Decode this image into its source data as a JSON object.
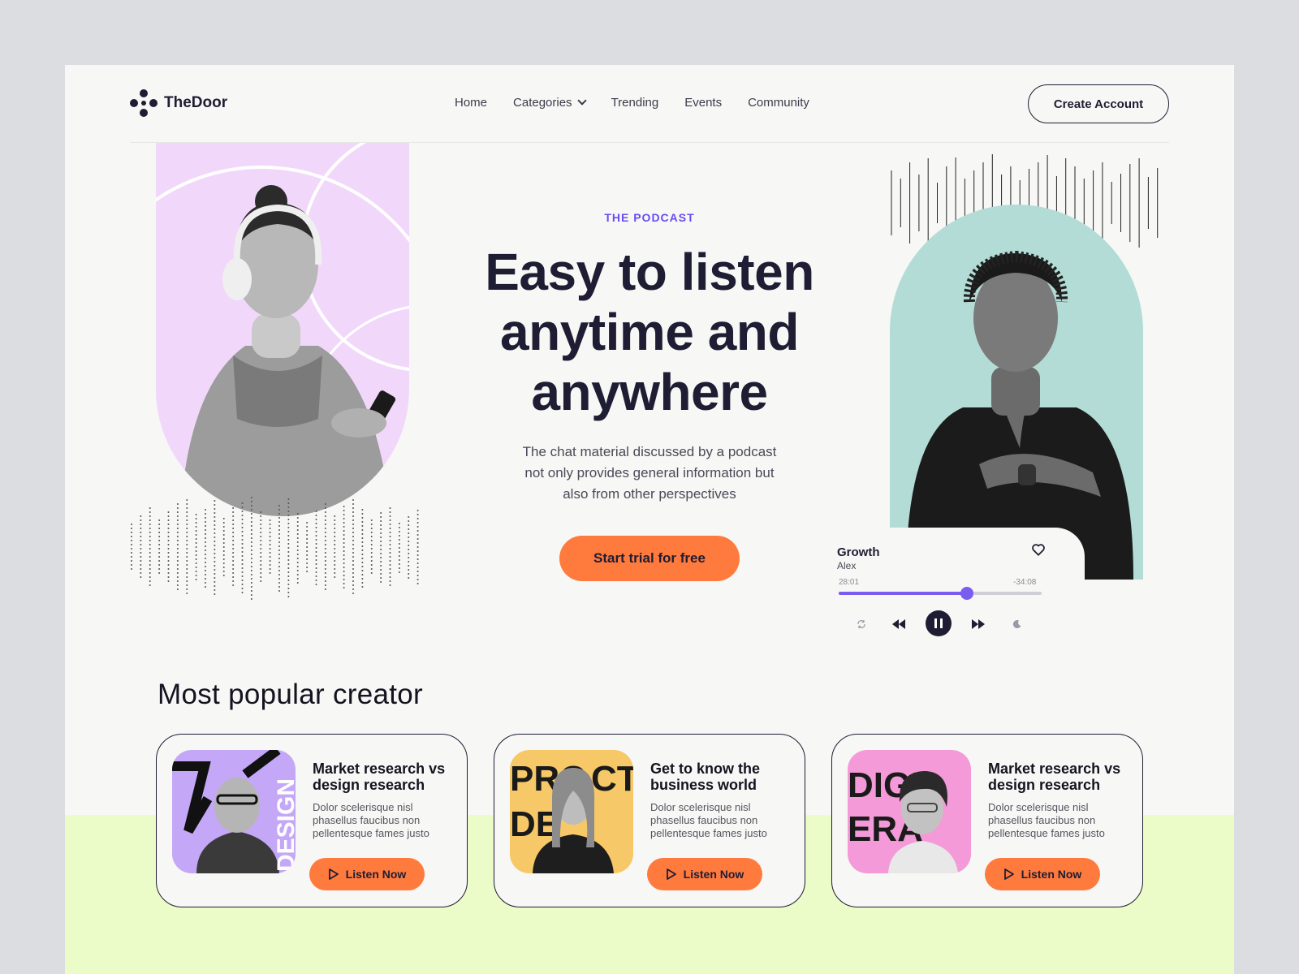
{
  "brand": {
    "name": "TheDoor"
  },
  "nav": {
    "items": [
      {
        "label": "Home"
      },
      {
        "label": "Categories",
        "has_dropdown": true
      },
      {
        "label": "Trending"
      },
      {
        "label": "Events"
      },
      {
        "label": "Community"
      }
    ],
    "cta_label": "Create Account"
  },
  "hero": {
    "eyebrow": "THE PODCAST",
    "headline_line1": "Easy to listen",
    "headline_line2": "anytime and",
    "headline_line3": "anywhere",
    "subtext_line1": "The chat material discussed by a podcast",
    "subtext_line2": "not only provides general information but",
    "subtext_line3": "also from other perspectives",
    "cta_label": "Start trial for free"
  },
  "player": {
    "title": "Growth",
    "artist": "Alex",
    "current_time": "28:01",
    "remaining_time": "-34:08",
    "progress": 0.63,
    "icons": [
      "repeat-icon",
      "rewind-icon",
      "pause-icon",
      "fast-forward-icon",
      "sleep-icon",
      "heart-icon"
    ]
  },
  "section": {
    "title": "Most popular creator"
  },
  "cards": [
    {
      "title": "Market research vs design research",
      "description": "Dolor scelerisque nisl phasellus faucibus non pellentesque fames justo",
      "button_label": "Listen Now",
      "bg_color": "#c4a8f7"
    },
    {
      "title": "Get to know the business world",
      "description": "Dolor scelerisque nisl phasellus faucibus non pellentesque fames justo",
      "button_label": "Listen Now",
      "bg_color": "#f7c867"
    },
    {
      "title": "Market research vs design research",
      "description": "Dolor scelerisque nisl phasellus faucibus non pellentesque fames justo",
      "button_label": "Listen Now",
      "bg_color": "#f59ad8"
    }
  ],
  "colors": {
    "accent_orange": "#ff7a3d",
    "accent_purple": "#6a4cf0",
    "lilac": "#f1d8fb",
    "mint": "#b3dcd6",
    "lime": "#ecfcc8",
    "ink": "#1f1d33"
  }
}
